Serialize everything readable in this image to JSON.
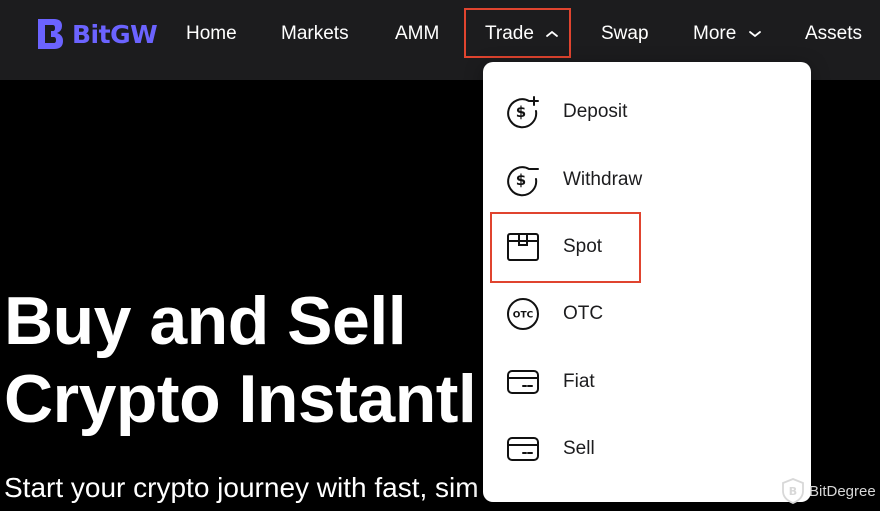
{
  "brand": {
    "name": "BitGW",
    "color": "#6b63ff"
  },
  "nav": {
    "items": [
      {
        "label": "Home"
      },
      {
        "label": "Markets"
      },
      {
        "label": "AMM"
      },
      {
        "label": "Trade",
        "icon": "chevron-up-icon"
      },
      {
        "label": "Swap"
      },
      {
        "label": "More",
        "icon": "chevron-down-icon"
      },
      {
        "label": "Assets"
      }
    ]
  },
  "trade_menu": {
    "items": [
      {
        "label": "Deposit",
        "icon": "dollar-plus-icon"
      },
      {
        "label": "Withdraw",
        "icon": "dollar-minus-icon"
      },
      {
        "label": "Spot",
        "icon": "box-icon"
      },
      {
        "label": "OTC",
        "icon": "otc-icon"
      },
      {
        "label": "Fiat",
        "icon": "card-icon"
      },
      {
        "label": "Sell",
        "icon": "card-icon"
      }
    ]
  },
  "hero": {
    "title_line1": "Buy and Sell",
    "title_line2": "Crypto Instantl",
    "subtitle": "Start your crypto journey with fast, sim"
  },
  "highlight_color": "#e0442f",
  "watermark": {
    "text": "BitDegree"
  }
}
